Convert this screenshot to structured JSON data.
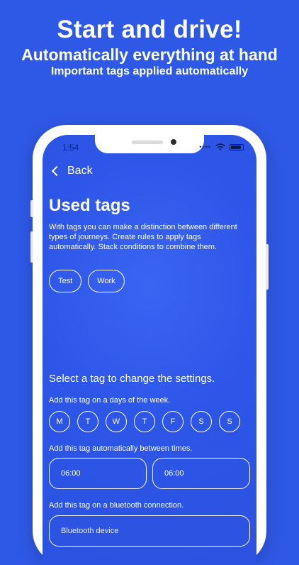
{
  "hero": {
    "title": "Start and drive!",
    "subtitle": "Automatically everything at hand",
    "caption": "Important tags applied automatically"
  },
  "status_bar": {
    "time": "1:54",
    "icons": [
      "signal-dots-icon",
      "wifi-icon",
      "battery-icon"
    ]
  },
  "nav": {
    "back_label": "Back",
    "back_icon": "chevron-left-icon"
  },
  "page": {
    "title": "Used tags",
    "description": "With tags you can make a distinction between different types of journeys. Create rules to apply tags automatically. Stack conditions to combine them."
  },
  "tags": [
    {
      "label": "Test"
    },
    {
      "label": "Work"
    }
  ],
  "settings": {
    "title": "Select a tag to change the settings.",
    "days_label": "Add this tag on a days of the week.",
    "days": [
      "M",
      "T",
      "W",
      "T",
      "F",
      "S",
      "S"
    ],
    "times_label": "Add this tag automatically between times.",
    "time_start": "06:00",
    "time_end": "06:00",
    "bluetooth_label": "Add this tag on a bluetooth connection.",
    "bluetooth_placeholder": "Bluetooth device"
  },
  "colors": {
    "background": "#2e58e6",
    "screen": "#2d56e8",
    "foreground": "#ffffff"
  }
}
